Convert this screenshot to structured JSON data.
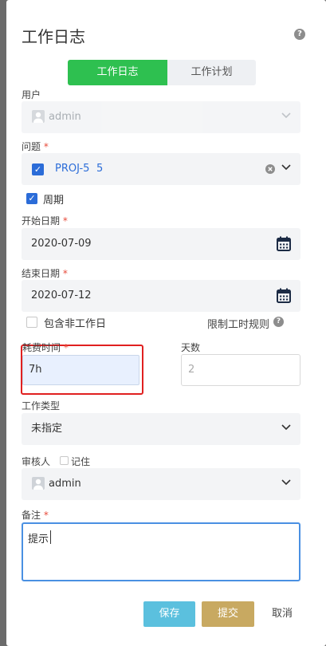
{
  "dialog": {
    "title": "工作日志"
  },
  "tabs": [
    {
      "label": "工作日志",
      "active": true
    },
    {
      "label": "工作计划",
      "active": false
    }
  ],
  "user": {
    "label": "用户",
    "value": "admin"
  },
  "issue": {
    "label": "问题",
    "required": "*",
    "key": "PROJ-5",
    "summary": "5"
  },
  "period": {
    "label": "周期",
    "checked": true
  },
  "start_date": {
    "label": "开始日期",
    "required": "*",
    "value": "2020-07-09"
  },
  "end_date": {
    "label": "结束日期",
    "required": "*",
    "value": "2020-07-12"
  },
  "include_non_working": {
    "label": "包含非工作日",
    "checked": false
  },
  "limit_rule": {
    "label": "限制工时规则"
  },
  "time_spent": {
    "label": "耗费时间",
    "required": "*",
    "value": "7h"
  },
  "days": {
    "label": "天数",
    "value": "2"
  },
  "work_type": {
    "label": "工作类型",
    "value": "未指定"
  },
  "reviewer": {
    "label": "审核人",
    "remember_label": "记住",
    "value": "admin"
  },
  "remark": {
    "label": "备注",
    "required": "*",
    "value": "提示"
  },
  "buttons": {
    "save": "保存",
    "submit": "提交",
    "cancel": "取消"
  },
  "colors": {
    "active_tab": "#2ec050",
    "save_button": "#5bc0de",
    "submit_button": "#c8a961",
    "checkbox": "#2b6cd8",
    "highlight": "#e02020",
    "focus_border": "#4a90e2"
  }
}
